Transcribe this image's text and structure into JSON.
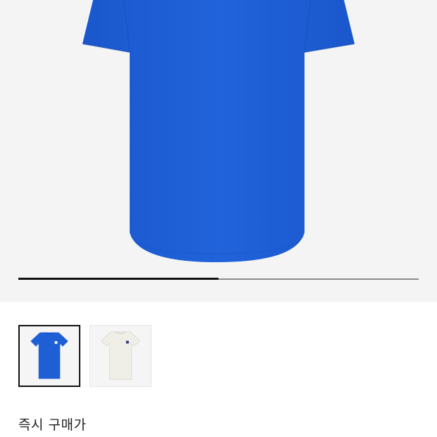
{
  "gallery": {
    "progress_fraction": 0.5
  },
  "thumbnails": [
    {
      "color_name": "blue",
      "shirt_color": "#1f5fd6",
      "selected": true
    },
    {
      "color_name": "off-white",
      "shirt_color": "#efeee7",
      "selected": false
    }
  ],
  "product": {
    "instant_buy_price_label": "즉시 구매가"
  },
  "colors": {
    "hero_background": "#f4f4f4",
    "shirt_blue": "#1f5fd6",
    "progress_track": "#8a8a8a",
    "progress_fill": "#111111"
  }
}
